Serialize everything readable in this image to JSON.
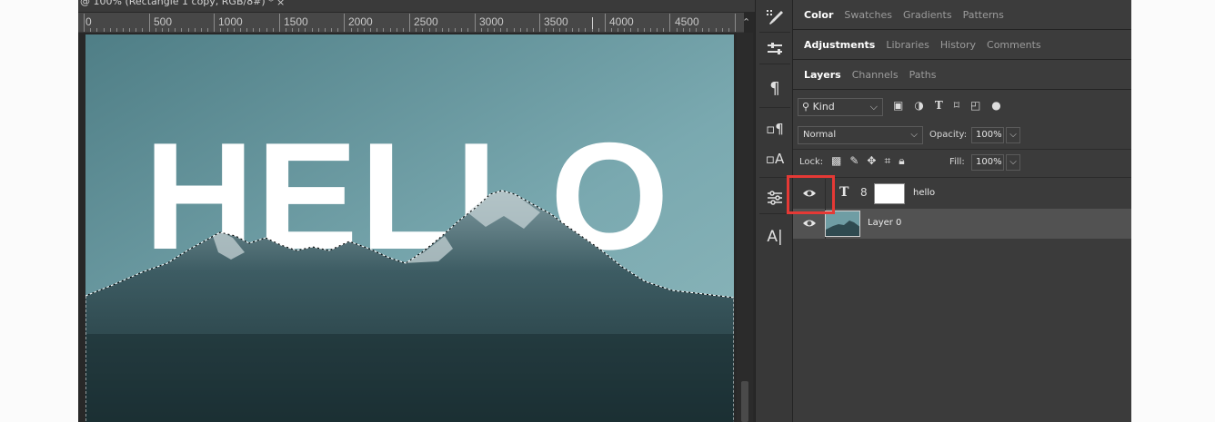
{
  "document": {
    "tab_title": "@ 100% (Rectangle 1 copy, RGB/8#) *",
    "close_glyph": "×"
  },
  "ruler": {
    "labels": [
      "0",
      "500",
      "1000",
      "1500",
      "2000",
      "2500",
      "3000",
      "3500",
      "4000",
      "4500"
    ]
  },
  "canvas": {
    "text": "HELLO"
  },
  "tools": {
    "items": [
      "brush-settings-icon",
      "properties-icon",
      "paragraph-icon",
      "paragraph-styles-icon",
      "character-styles-icon",
      "adjustments-icon",
      "character-icon"
    ]
  },
  "panels": {
    "row1": [
      "Color",
      "Swatches",
      "Gradients",
      "Patterns"
    ],
    "row2": [
      "Adjustments",
      "Libraries",
      "History",
      "Comments"
    ],
    "row3": [
      "Layers",
      "Channels",
      "Paths"
    ]
  },
  "layers": {
    "filter_kind": "Kind",
    "blend_mode": "Normal",
    "opacity_label": "Opacity:",
    "opacity_value": "100%",
    "lock_label": "Lock:",
    "fill_label": "Fill:",
    "fill_value": "100%",
    "items": [
      {
        "name": "hello",
        "type": "text",
        "visible": true
      },
      {
        "name": "Layer 0",
        "type": "image",
        "visible": true
      }
    ]
  },
  "colors": {
    "highlight": "#e53935",
    "selected_row": "#525252"
  }
}
